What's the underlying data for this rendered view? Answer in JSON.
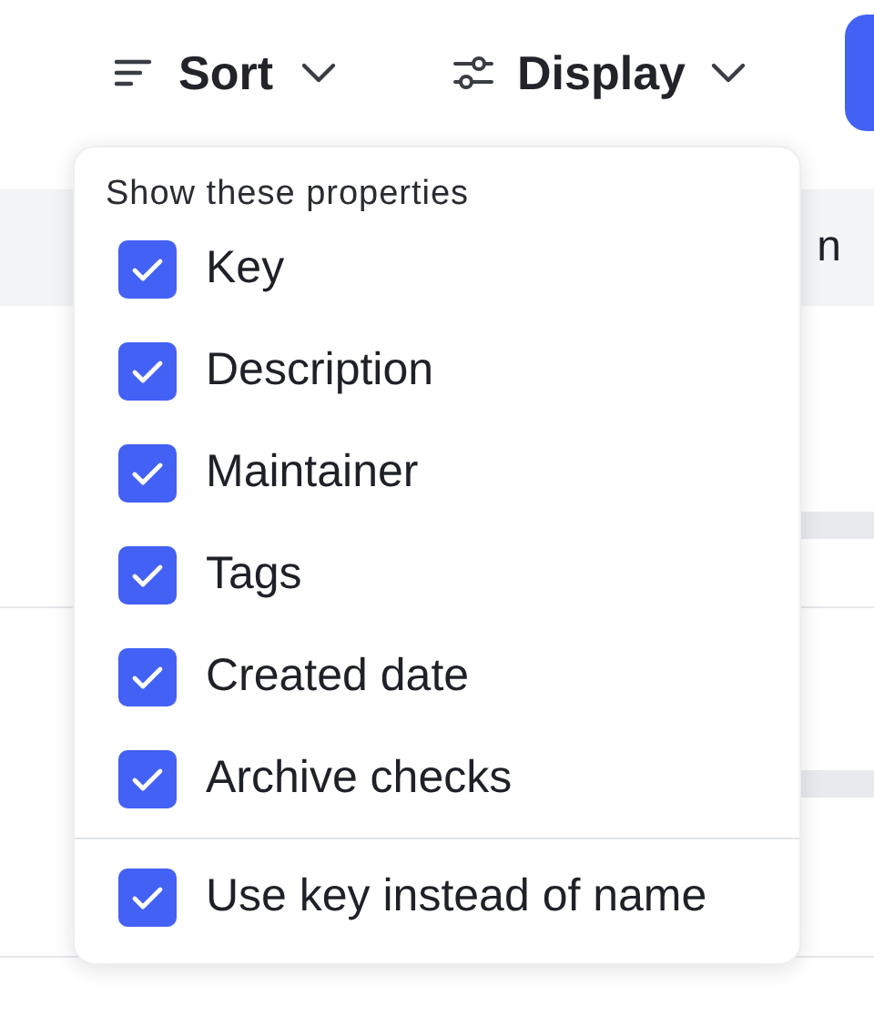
{
  "toolbar": {
    "sort": {
      "label": "Sort"
    },
    "display": {
      "label": "Display"
    }
  },
  "table": {
    "column_1": "n"
  },
  "menu": {
    "title": "Show these properties",
    "properties": [
      {
        "label": "Key",
        "checked": true
      },
      {
        "label": "Description",
        "checked": true
      },
      {
        "label": "Maintainer",
        "checked": true
      },
      {
        "label": "Tags",
        "checked": true
      },
      {
        "label": "Created date",
        "checked": true
      },
      {
        "label": "Archive checks",
        "checked": true
      }
    ],
    "options": [
      {
        "label": "Use key instead of name",
        "checked": true
      }
    ]
  }
}
